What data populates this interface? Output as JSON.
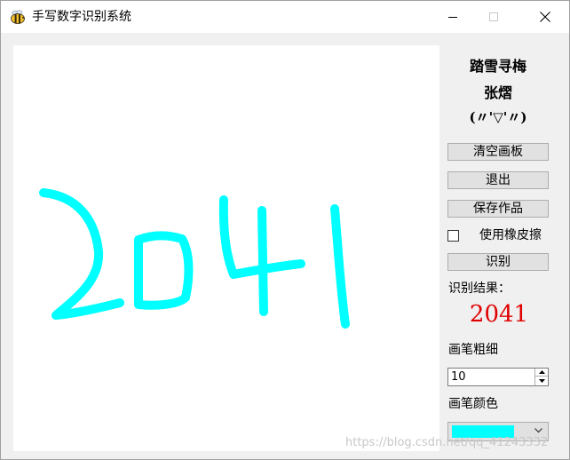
{
  "window": {
    "title": "手写数字识别系统"
  },
  "sidebar": {
    "author_line1": "踏雪寻梅",
    "author_line2": "张熠",
    "author_line3": "(〃'▽'〃)",
    "clear_label": "清空画板",
    "exit_label": "退出",
    "save_label": "保存作品",
    "eraser_label": "使用橡皮擦",
    "eraser_checked": false,
    "recognize_label": "识别",
    "result_label": "识别结果：",
    "result_value": "2041",
    "pen_width_label": "画笔粗细",
    "pen_width_value": "10",
    "pen_color_label": "画笔颜色",
    "pen_color": "#00ffff"
  },
  "colors": {
    "stroke": "#00ffff",
    "result": "#e00000"
  },
  "watermark": "https://blog.csdn.net/qq_41243332"
}
